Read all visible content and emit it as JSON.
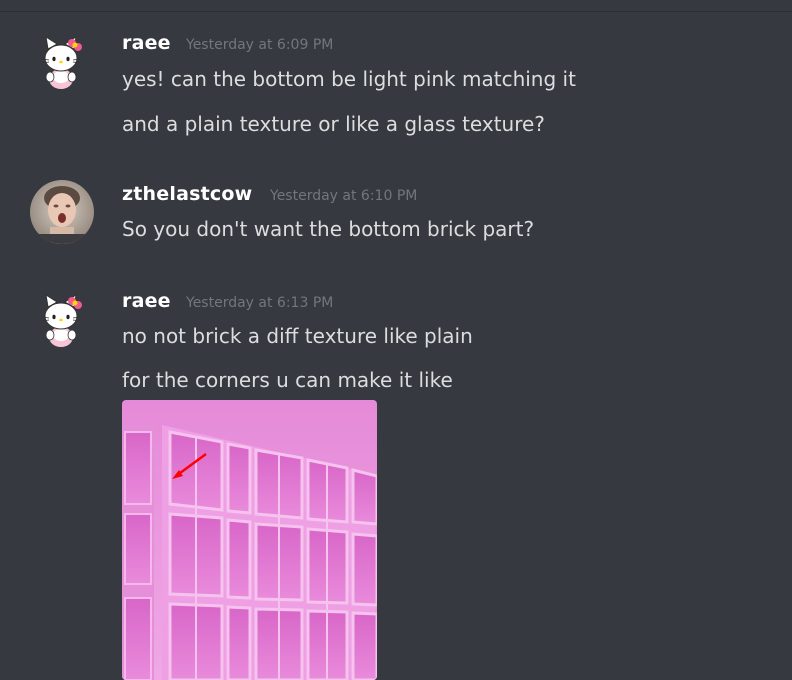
{
  "messages": [
    {
      "username": "raee",
      "timestamp": "Yesterday at 6:09 PM",
      "avatar": "hello-kitty-avatar",
      "lines": [
        "yes! can the bottom be light pink matching it",
        "and a plain texture or like a glass texture?"
      ]
    },
    {
      "username": "zthelastcow",
      "timestamp": "Yesterday at 6:10 PM",
      "avatar": "person-photo-avatar",
      "lines": [
        "So you don't want the bottom brick part?"
      ]
    },
    {
      "username": "raee",
      "timestamp": "Yesterday at 6:13 PM",
      "avatar": "hello-kitty-avatar",
      "lines": [
        "no not brick a diff texture like plain",
        "for the corners u can make it like"
      ],
      "attachment": "pink-glass-building-image"
    }
  ],
  "colors": {
    "background": "#36393f",
    "username": "#ffffff",
    "timestamp": "#72767d",
    "message_text": "#dcddde",
    "image_pink": "#e27fd1"
  }
}
